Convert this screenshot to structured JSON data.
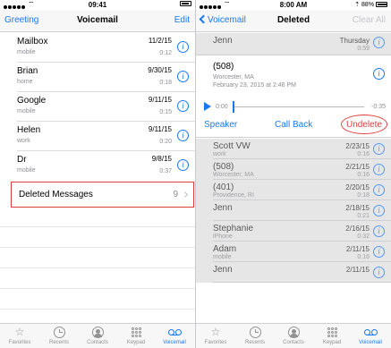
{
  "left": {
    "status": {
      "carrier_dots": 5,
      "time": "09:41",
      "battery_level": 0.75
    },
    "nav": {
      "left_button": "Greeting",
      "title": "Voicemail",
      "right_button": "Edit"
    },
    "voicemails": [
      {
        "name": "Mailbox",
        "sub": "mobile",
        "date": "11/2/15",
        "duration": "0:12"
      },
      {
        "name": "Brian",
        "sub": "home",
        "date": "9/30/15",
        "duration": "0:18"
      },
      {
        "name": "Google",
        "sub": "mobile",
        "date": "9/11/15",
        "duration": "0:15"
      },
      {
        "name": "Helen",
        "sub": "work",
        "date": "9/11/15",
        "duration": "0:20"
      },
      {
        "name": "Dr",
        "sub": "mobile",
        "date": "9/8/15",
        "duration": "0:37"
      }
    ],
    "deleted": {
      "label": "Deleted Messages",
      "count": "9"
    },
    "tabs": [
      {
        "label": "Favorites",
        "icon": "star-icon"
      },
      {
        "label": "Recents",
        "icon": "clock-icon"
      },
      {
        "label": "Contacts",
        "icon": "contacts-icon"
      },
      {
        "label": "Keypad",
        "icon": "keypad-icon"
      },
      {
        "label": "Voicemail",
        "icon": "voicemail-icon",
        "active": true
      }
    ]
  },
  "right": {
    "status": {
      "carrier_dots": 5,
      "time": "8:00 AM",
      "battery_text": "88%",
      "battery_level": 0.88
    },
    "nav": {
      "back_button": "Voicemail",
      "title": "Deleted",
      "right_button": "Clear All"
    },
    "top_item": {
      "name": "Jenn",
      "date": "Thursday",
      "duration": "0:59"
    },
    "expanded": {
      "name": "(508)",
      "location": "Worcester, MA",
      "when": "February 23, 2015 at 2:46 PM",
      "elapsed": "0:00",
      "remaining": "-0:35",
      "actions": {
        "speaker": "Speaker",
        "call_back": "Call Back",
        "undelete": "Undelete"
      }
    },
    "items": [
      {
        "name": "Scott VW",
        "sub": "work",
        "date": "2/23/15",
        "duration": "0:16"
      },
      {
        "name": "(508)",
        "sub": "Worcester, MA",
        "date": "2/21/15",
        "duration": "0:16"
      },
      {
        "name": "(401)",
        "sub": "Providence, RI",
        "date": "2/20/15",
        "duration": "0:18"
      },
      {
        "name": "Jenn",
        "sub": "",
        "date": "2/18/15",
        "duration": "0:21"
      },
      {
        "name": "Stephanie",
        "sub": "iPhone",
        "date": "2/16/15",
        "duration": "0:32"
      },
      {
        "name": "Adam",
        "sub": "mobile",
        "date": "2/11/15",
        "duration": "0:16"
      },
      {
        "name": "Jenn",
        "sub": "",
        "date": "2/11/15",
        "duration": ""
      }
    ],
    "tabs": [
      {
        "label": "Favorites",
        "icon": "star-icon"
      },
      {
        "label": "Recents",
        "icon": "clock-icon"
      },
      {
        "label": "Contacts",
        "icon": "contacts-icon"
      },
      {
        "label": "Keypad",
        "icon": "keypad-icon"
      },
      {
        "label": "Voicemail",
        "icon": "voicemail-icon",
        "active": true
      }
    ]
  },
  "colors": {
    "accent": "#1a78f2",
    "highlight": "#e03c3c"
  }
}
